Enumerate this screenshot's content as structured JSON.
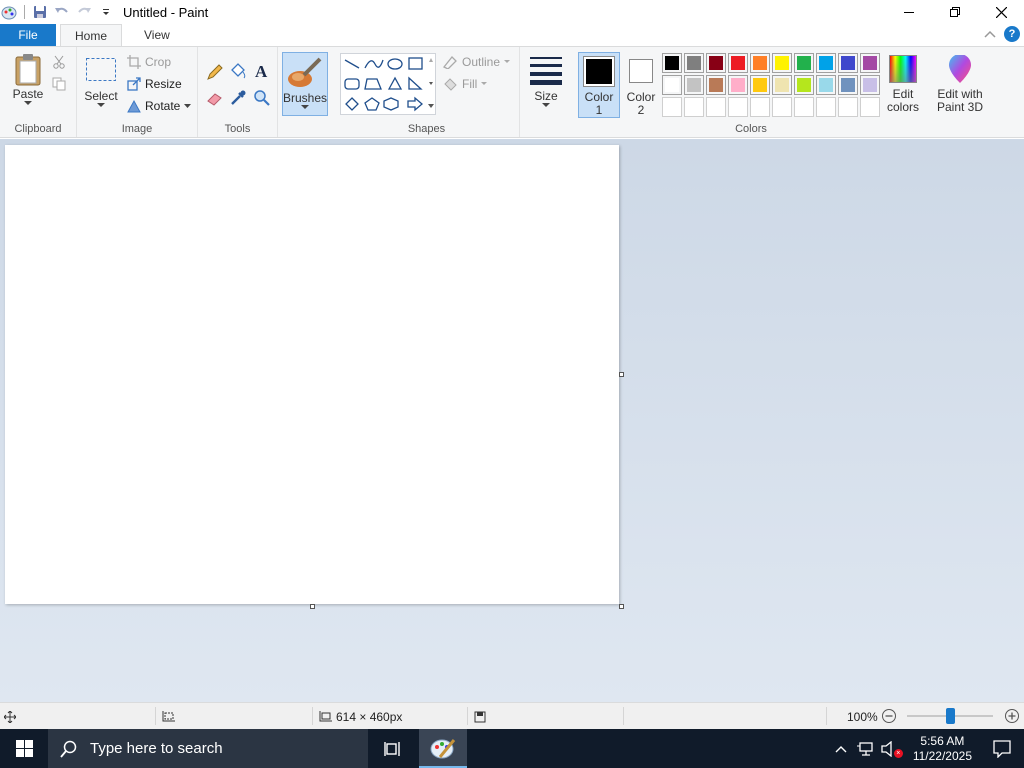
{
  "window": {
    "title": "Untitled - Paint",
    "minimize_icon": "minimize-icon",
    "maximize_icon": "restore-icon",
    "close_icon": "close-icon"
  },
  "tabs": {
    "file": "File",
    "home": "Home",
    "view": "View"
  },
  "ribbon": {
    "clipboard": {
      "label": "Clipboard",
      "paste": "Paste"
    },
    "image": {
      "label": "Image",
      "select": "Select",
      "crop": "Crop",
      "resize": "Resize",
      "rotate": "Rotate"
    },
    "tools": {
      "label": "Tools"
    },
    "brushes": {
      "label": "Brushes"
    },
    "shapes": {
      "label": "Shapes",
      "outline": "Outline",
      "fill": "Fill"
    },
    "size": {
      "label": "Size"
    },
    "color1": {
      "label": "Color",
      "num": "1",
      "value": "#000000"
    },
    "color2": {
      "label": "Color",
      "num": "2",
      "value": "#ffffff"
    },
    "colors": {
      "label": "Colors",
      "row1": [
        "#000000",
        "#7f7f7f",
        "#880015",
        "#ed1c24",
        "#ff7f27",
        "#fff200",
        "#22b14c",
        "#00a2e8",
        "#3f48cc",
        "#a349a4"
      ],
      "row2": [
        "#ffffff",
        "#c3c3c3",
        "#b97a57",
        "#ffaec9",
        "#ffc90e",
        "#efe4b0",
        "#b5e61d",
        "#99d9ea",
        "#7092be",
        "#c8bfe7"
      ],
      "row3": [
        "#ffffff",
        "#ffffff",
        "#ffffff",
        "#ffffff",
        "#ffffff",
        "#ffffff",
        "#ffffff",
        "#ffffff",
        "#ffffff",
        "#ffffff"
      ]
    },
    "edit_colors": {
      "line1": "Edit",
      "line2": "colors"
    },
    "paint3d": {
      "line1": "Edit with",
      "line2": "Paint 3D"
    }
  },
  "status": {
    "canvas_size": "614 × 460px",
    "zoom": "100%",
    "zoom_level": 0.5
  },
  "taskbar": {
    "search_placeholder": "Type here to search",
    "time": "5:56 AM",
    "date": "11/22/2025"
  }
}
